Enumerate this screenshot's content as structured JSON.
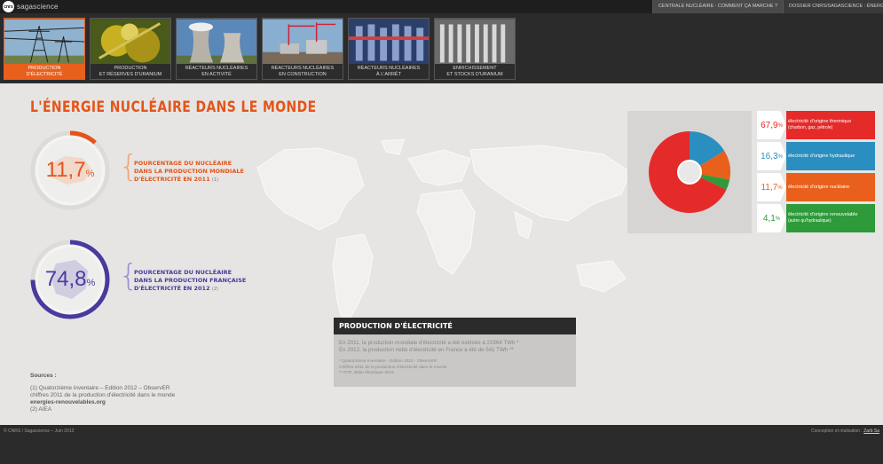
{
  "header": {
    "logo_mark": "cnrs",
    "logo_text": "sagascience",
    "nav": [
      "CENTRALE NUCLÉAIRE : COMMENT ÇA MARCHE ?",
      "DOSSIER CNRS/SAGASCIENCE : ÉNERGIE NU"
    ]
  },
  "thumbnails": [
    {
      "line1": "PRODUCTION",
      "line2": "D'ÉLECTRICITÉ",
      "active": true
    },
    {
      "line1": "PRODUCTION",
      "line2": "ET RÉSERVES D'URANIUM",
      "active": false
    },
    {
      "line1": "RÉACTEURS NUCLÉAIRES",
      "line2": "EN ACTIVITÉ",
      "active": false
    },
    {
      "line1": "RÉACTEURS NUCLÉAIRES",
      "line2": "EN CONSTRUCTION",
      "active": false
    },
    {
      "line1": "RÉACTEURS NUCLÉAIRES",
      "line2": "À L'ARRÊT",
      "active": false
    },
    {
      "line1": "ENRICHISSEMENT",
      "line2": "ET STOCKS D'URANIUM",
      "active": false
    }
  ],
  "main": {
    "title": "L'ÉNERGIE NUCLÉAIRE DANS LE MONDE",
    "world_stat": {
      "value": "11,7",
      "unit": "%",
      "fraction": 0.117,
      "color": "#e3551b",
      "label_lines": [
        "POURCENTAGE DU NUCLÉAIRE",
        "DANS LA PRODUCTION MONDIALE",
        "D'ÉLECTRICITÉ EN 2011"
      ],
      "ref": "(1)"
    },
    "france_stat": {
      "value": "74,8",
      "unit": "%",
      "fraction": 0.748,
      "color": "#4a3a9e",
      "label_lines": [
        "POURCENTAGE DU NUCLÉAIRE",
        "DANS LA PRODUCTION FRANÇAISE",
        "D'ÉLECTRICITÉ EN 2012"
      ],
      "ref": "(2)"
    },
    "sources": {
      "heading": "Sources :",
      "line1": "(1) Quatorzième inventaire – Edition 2012 – ObservER",
      "line2": "chiffres 2011 de la production d'électricité dans le monde",
      "line3": "energies-renouvelables.org",
      "line4": "(2) AIEA"
    },
    "production_box": {
      "heading": "PRODUCTION D'ÉLECTRICITÉ",
      "body1": "En 2011, la production mondiale d'électricité a été estimée à 21964 TWh *",
      "body2": "En 2012, la production nette d'électricité en France a été de 541 TWh **",
      "note1": "*   Quatorzième inventaire - Edition 2012 - ObservER",
      "note2": "Chiffres 2011 de la production d'électricité dans le monde",
      "note3": "**   RTE, Bilan électrique 2012"
    }
  },
  "chart_data": {
    "type": "pie",
    "series": [
      {
        "name": "électricité d'origine thermique",
        "sub": "(charbon, gaz, pétrole)",
        "label": "67,9",
        "unit": "%",
        "value": 67.9,
        "color": "#e52a2a",
        "text_color": "#e52a2a"
      },
      {
        "name": "électricité d'origine hydraulique",
        "sub": "",
        "label": "16,3",
        "unit": "%",
        "value": 16.3,
        "color": "#2a8fc0",
        "text_color": "#2a8fc0"
      },
      {
        "name": "électricité d'origine nucléaire",
        "sub": "",
        "label": "11,7",
        "unit": "%",
        "value": 11.7,
        "color": "#e8601c",
        "text_color": "#e8601c"
      },
      {
        "name": "électricité d'origine renouvelable",
        "sub": "(autre qu'hydraulique)",
        "label": "4,1",
        "unit": "%",
        "value": 4.1,
        "color": "#2e9a3a",
        "text_color": "#2e9a3a"
      }
    ]
  },
  "footer": {
    "copyright": "© CNRS / Sagascience – Juin 2013",
    "credit_label": "Conception et réalisation :",
    "credit_link": "Zarb Sa"
  }
}
